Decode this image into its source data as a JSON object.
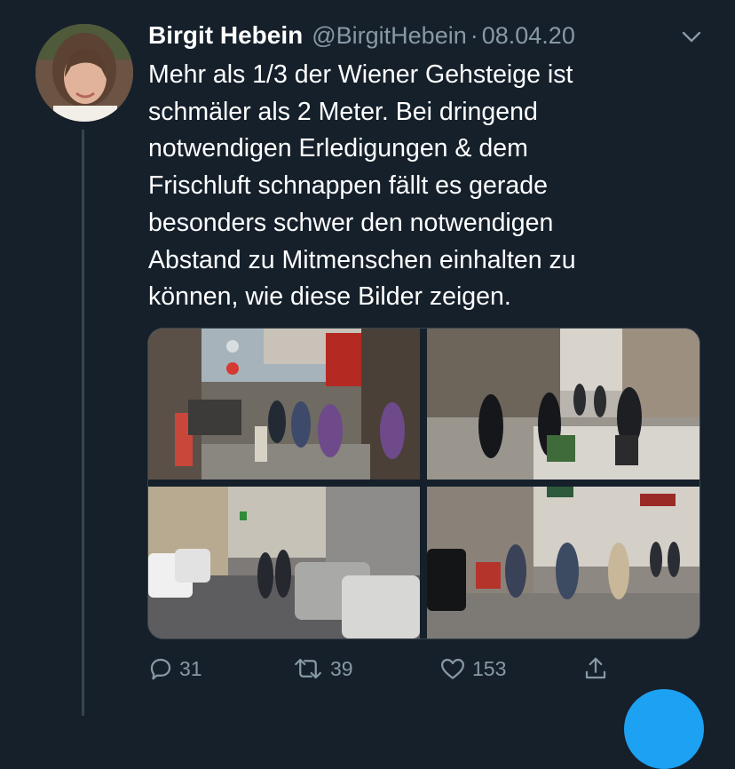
{
  "tweet": {
    "author_name": "Birgit Hebein",
    "handle": "@BirgitHebein",
    "separator": "·",
    "date": "08.04.20",
    "text": "Mehr als 1/3 der Wiener Gehsteige ist\nschmäler als 2 Meter. Bei dringend\nnotwendigen Erledigungen & dem\nFrischluft schnappen fällt es gerade\nbesonders schwer den notwendigen\nAbstand zu Mitmenschen einhalten zu\nkönnen, wie diese Bilder zeigen."
  },
  "actions": {
    "reply_count": "31",
    "retweet_count": "39",
    "like_count": "153"
  },
  "icons": {
    "reply": "speech-bubble-icon",
    "retweet": "retweet-arrows-icon",
    "like": "heart-icon",
    "share": "share-upload-icon",
    "more": "chevron-down-icon"
  },
  "colors": {
    "background": "#15202b",
    "secondary_text": "#8899a6",
    "divider": "#38444d",
    "accent": "#1da1f2"
  }
}
